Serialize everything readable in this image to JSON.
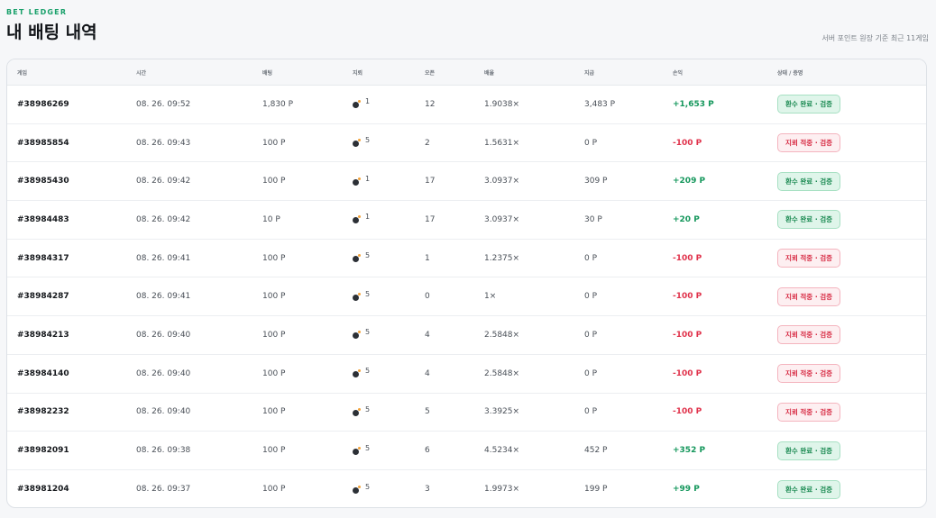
{
  "header": {
    "eyebrow": "BET LEDGER",
    "title": "내 배팅 내역",
    "summary": "서버 포인트 원장 기준 최근 11게임"
  },
  "table": {
    "columns": {
      "game": "게임",
      "time": "시간",
      "bet": "배팅",
      "mines": "지뢰",
      "open": "오픈",
      "multiplier": "배율",
      "payout": "지급",
      "pnl": "손익",
      "status": "상태 / 증명"
    },
    "rows": [
      {
        "game": "#38986269",
        "time": "08. 26. 09:52",
        "bet": "1,830 P",
        "mines": "1",
        "open": "12",
        "multiplier": "1.9038×",
        "payout": "3,483 P",
        "pnl": "+1,653 P",
        "status": "환수 완료 · 검증",
        "result": "win"
      },
      {
        "game": "#38985854",
        "time": "08. 26. 09:43",
        "bet": "100 P",
        "mines": "5",
        "open": "2",
        "multiplier": "1.5631×",
        "payout": "0 P",
        "pnl": "-100 P",
        "status": "지뢰 적중 · 검증",
        "result": "loss"
      },
      {
        "game": "#38985430",
        "time": "08. 26. 09:42",
        "bet": "100 P",
        "mines": "1",
        "open": "17",
        "multiplier": "3.0937×",
        "payout": "309 P",
        "pnl": "+209 P",
        "status": "환수 완료 · 검증",
        "result": "win"
      },
      {
        "game": "#38984483",
        "time": "08. 26. 09:42",
        "bet": "10 P",
        "mines": "1",
        "open": "17",
        "multiplier": "3.0937×",
        "payout": "30 P",
        "pnl": "+20 P",
        "status": "환수 완료 · 검증",
        "result": "win"
      },
      {
        "game": "#38984317",
        "time": "08. 26. 09:41",
        "bet": "100 P",
        "mines": "5",
        "open": "1",
        "multiplier": "1.2375×",
        "payout": "0 P",
        "pnl": "-100 P",
        "status": "지뢰 적중 · 검증",
        "result": "loss"
      },
      {
        "game": "#38984287",
        "time": "08. 26. 09:41",
        "bet": "100 P",
        "mines": "5",
        "open": "0",
        "multiplier": "1×",
        "payout": "0 P",
        "pnl": "-100 P",
        "status": "지뢰 적중 · 검증",
        "result": "loss"
      },
      {
        "game": "#38984213",
        "time": "08. 26. 09:40",
        "bet": "100 P",
        "mines": "5",
        "open": "4",
        "multiplier": "2.5848×",
        "payout": "0 P",
        "pnl": "-100 P",
        "status": "지뢰 적중 · 검증",
        "result": "loss"
      },
      {
        "game": "#38984140",
        "time": "08. 26. 09:40",
        "bet": "100 P",
        "mines": "5",
        "open": "4",
        "multiplier": "2.5848×",
        "payout": "0 P",
        "pnl": "-100 P",
        "status": "지뢰 적중 · 검증",
        "result": "loss"
      },
      {
        "game": "#38982232",
        "time": "08. 26. 09:40",
        "bet": "100 P",
        "mines": "5",
        "open": "5",
        "multiplier": "3.3925×",
        "payout": "0 P",
        "pnl": "-100 P",
        "status": "지뢰 적중 · 검증",
        "result": "loss"
      },
      {
        "game": "#38982091",
        "time": "08. 26. 09:38",
        "bet": "100 P",
        "mines": "5",
        "open": "6",
        "multiplier": "4.5234×",
        "payout": "452 P",
        "pnl": "+352 P",
        "status": "환수 완료 · 검증",
        "result": "win"
      },
      {
        "game": "#38981204",
        "time": "08. 26. 09:37",
        "bet": "100 P",
        "mines": "5",
        "open": "3",
        "multiplier": "1.9973×",
        "payout": "199 P",
        "pnl": "+99 P",
        "status": "환수 완료 · 검증",
        "result": "win"
      }
    ]
  },
  "icons": {
    "mines": "bomb-icon"
  },
  "colors": {
    "accent": "#18a06a",
    "positive": "#15975c",
    "negative": "#e0324b",
    "win_badge_bg": "#dff5ea",
    "loss_badge_bg": "#fdeff1"
  }
}
